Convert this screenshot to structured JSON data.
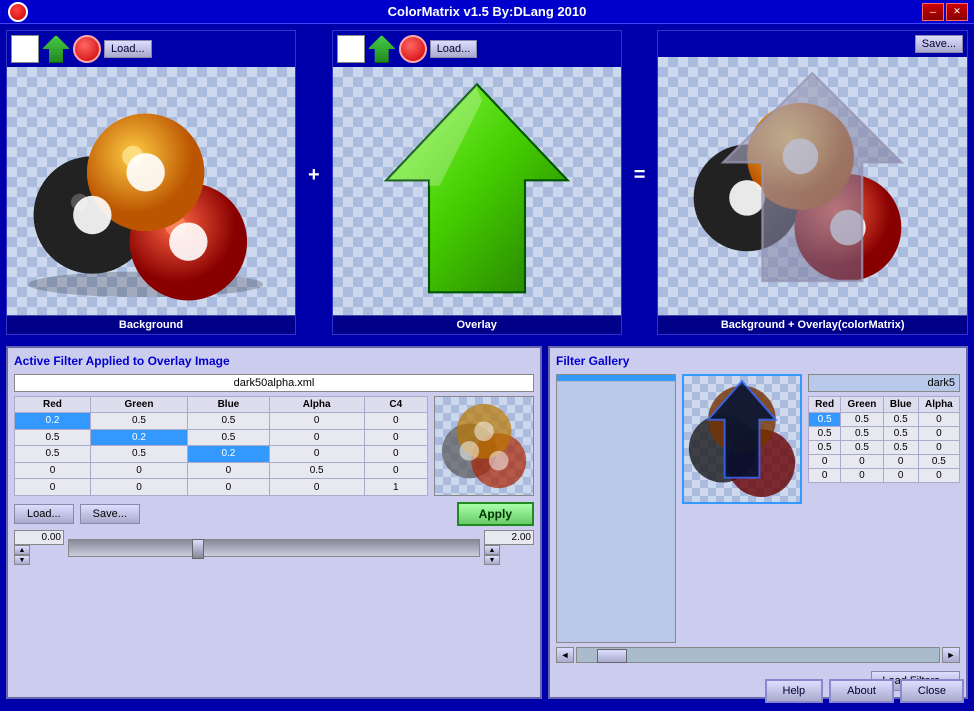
{
  "title": "ColorMatrix v1.5 By:DLang 2010",
  "top": {
    "panel1": {
      "label": "Background",
      "load_btn": "Load..."
    },
    "panel2": {
      "label": "Overlay",
      "load_btn": "Load..."
    },
    "panel3": {
      "label": "Background + Overlay(colorMatrix)",
      "save_btn": "Save..."
    },
    "plus_sign": "+",
    "equals_sign": "="
  },
  "active_filter": {
    "title": "Active Filter Applied to Overlay Image",
    "filename": "dark50alpha.xml",
    "columns": [
      "Red",
      "Green",
      "Blue",
      "Alpha",
      "C4"
    ],
    "rows": [
      [
        "0.2",
        "0.5",
        "0.5",
        "0",
        "0"
      ],
      [
        "0.5",
        "0.2",
        "0.5",
        "0",
        "0"
      ],
      [
        "0.5",
        "0.5",
        "0.2",
        "0",
        "0"
      ],
      [
        "0",
        "0",
        "0",
        "0.5",
        "0"
      ],
      [
        "0",
        "0",
        "0",
        "0",
        "1"
      ]
    ],
    "selected_cells": [
      [
        0,
        0
      ],
      [
        1,
        1
      ],
      [
        2,
        2
      ]
    ],
    "load_btn": "Load...",
    "save_btn": "Save...",
    "apply_btn": "Apply",
    "slider_min": "0.00",
    "slider_max": "2.00"
  },
  "filter_gallery": {
    "title": "Filter Gallery",
    "filename": "dark5",
    "columns": [
      "Red",
      "Green",
      "Blue",
      "Alpha"
    ],
    "rows": [
      [
        "0.5",
        "0.5",
        "0.5",
        "0"
      ],
      [
        "0.5",
        "0.5",
        "0.5",
        "0"
      ],
      [
        "0.5",
        "0.5",
        "0.5",
        "0"
      ],
      [
        "0",
        "0",
        "0",
        "0.5"
      ],
      [
        "0",
        "0",
        "0",
        "0"
      ]
    ],
    "selected_cells": [
      [
        0,
        0
      ]
    ],
    "load_filters_btn": "Load Filters...",
    "help_btn": "Help",
    "about_btn": "About",
    "close_btn": "Close"
  },
  "icons": {
    "title_icon": "●",
    "minimize": "─",
    "close": "✕",
    "arrow_up": "▲",
    "arrow_down": "▼",
    "scroll_left": "◄",
    "scroll_right": "►"
  }
}
